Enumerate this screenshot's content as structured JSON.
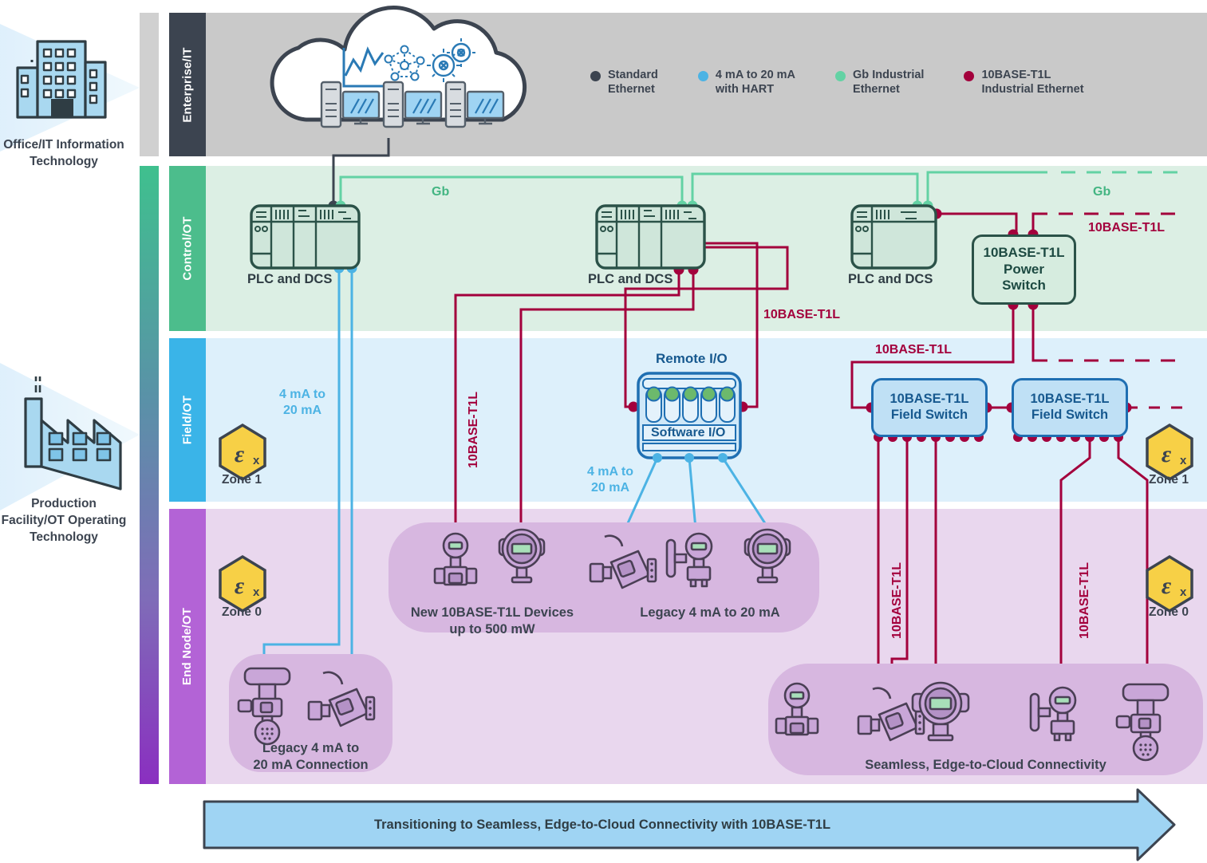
{
  "sidebar": {
    "office": {
      "icon": "office-building-icon",
      "label": "Office/IT\nInformation\nTechnology"
    },
    "production": {
      "icon": "factory-icon",
      "label": "Production\nFacility/OT\nOperating\nTechnology"
    }
  },
  "bands": [
    {
      "key": "enterprise",
      "label": "Enterprise/IT",
      "tab_color": "#3c4450",
      "bg_color": "#c9c9c9"
    },
    {
      "key": "control",
      "label": "Control/OT",
      "tab_color": "#4cbd8c",
      "bg_color": "#dcefe4"
    },
    {
      "key": "field",
      "label": "Field/OT",
      "tab_color": "#3ab4e8",
      "bg_color": "#ddf0fb"
    },
    {
      "key": "endnode",
      "label": "End Node/OT",
      "tab_color": "#b363d6",
      "bg_color": "#e9d7ee"
    }
  ],
  "legend": {
    "items": [
      {
        "label": "Standard\nEthernet",
        "color": "#3c4450",
        "icon": "legend-dot-icon"
      },
      {
        "label": "4 mA to 20 mA\nwith HART",
        "color": "#4cb3e4",
        "icon": "legend-dot-icon"
      },
      {
        "label": "Gb Industrial\nEthernet",
        "color": "#63d2a4",
        "icon": "legend-dot-icon"
      },
      {
        "label": "10BASE-T1L\nIndustrial Ethernet",
        "color": "#a3003c",
        "icon": "legend-dot-icon"
      }
    ]
  },
  "cloud": {
    "icon": "cloud-icon",
    "inner_icons": [
      "analytics-chart-icon",
      "network-graph-icon",
      "gears-settings-icon",
      "server-icon",
      "monitor-icon",
      "server-icon",
      "monitor-icon",
      "server-icon",
      "monitor-icon"
    ]
  },
  "plcs": [
    {
      "id": "plc-1",
      "label": "PLC and DCS"
    },
    {
      "id": "plc-2",
      "label": "PLC and DCS"
    },
    {
      "id": "plc-3",
      "label": "PLC and DCS"
    }
  ],
  "power_switch": {
    "label": "10BASE-T1L\nPower\nSwitch"
  },
  "field_switches": [
    {
      "id": "field-switch-1",
      "label": "10BASE-T1L\nField Switch"
    },
    {
      "id": "field-switch-2",
      "label": "10BASE-T1L\nField Switch"
    }
  ],
  "remote_io": {
    "title": "Remote I/O",
    "software_label": "Software I/O",
    "channels": 5
  },
  "network_labels": {
    "gb_left": "Gb",
    "gb_right": "Gb",
    "t1l_control": "10BASE-T1L",
    "t1l_right_control": "10BASE-T1L",
    "t1l_field": "10BASE-T1L",
    "t1l_vert_left": "10BASE-T1L",
    "t1l_vert_mid_right": "10BASE-T1L",
    "t1l_vert_far_right": "10BASE-T1L",
    "ma_left": "4 mA to\n20 mA",
    "ma_remote": "4 mA to\n20 mA"
  },
  "zones": [
    {
      "id": "zone-left-field",
      "icon": "atex-ex-icon",
      "label": "Zone 1"
    },
    {
      "id": "zone-left-end",
      "icon": "atex-ex-icon",
      "label": "Zone 0"
    },
    {
      "id": "zone-right-field",
      "icon": "atex-ex-icon",
      "label": "Zone 1"
    },
    {
      "id": "zone-right-end",
      "icon": "atex-ex-icon",
      "label": "Zone 0"
    }
  ],
  "device_groups": [
    {
      "id": "group-legacy-left",
      "label": "Legacy 4 mA to\n20 mA Connection",
      "devices": [
        "control-valve-icon",
        "flow-transmitter-icon"
      ]
    },
    {
      "id": "group-new-t1l",
      "label": "New 10BASE-T1L Devices\nup to 500 mW",
      "devices": [
        "flow-meter-icon",
        "pressure-transmitter-icon"
      ]
    },
    {
      "id": "group-legacy-mid",
      "label": "Legacy 4 mA to 20 mA",
      "devices": [
        "valve-positioner-icon",
        "gauge-transmitter-icon",
        "pressure-transmitter-icon"
      ]
    },
    {
      "id": "group-seamless",
      "label": "Seamless, Edge-to-Cloud Connectivity",
      "devices": [
        "flow-meter-icon",
        "valve-positioner-icon",
        "inline-transmitter-icon",
        "gauge-transmitter-icon",
        "control-valve-icon"
      ]
    }
  ],
  "banner": {
    "label": "Transitioning to Seamless, Edge-to-Cloud Connectivity with 10BASE-T1L"
  },
  "colors": {
    "standard_ethernet": "#3c4450",
    "current_loop": "#4cb3e4",
    "gb_ethernet": "#63d2a4",
    "t1l": "#a3003c",
    "atex_yellow": "#f7d046"
  }
}
